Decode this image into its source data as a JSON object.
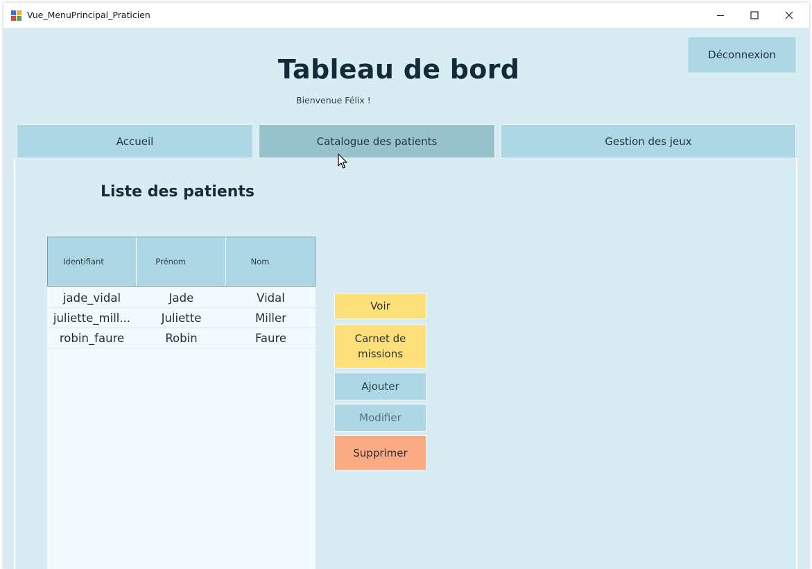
{
  "window": {
    "title": "Vue_MenuPrincipal_Praticien"
  },
  "header": {
    "logout_label": "Déconnexion",
    "title": "Tableau de bord",
    "welcome": "Bienvenue Félix !"
  },
  "tabs": [
    {
      "label": "Accueil",
      "active": false
    },
    {
      "label": "Catalogue des patients",
      "active": true
    },
    {
      "label": "Gestion des jeux",
      "active": false
    }
  ],
  "patients": {
    "title": "Liste des patients",
    "columns": [
      "Identifiant",
      "Prénom",
      "Nom"
    ],
    "rows": [
      [
        "jade_vidal",
        "Jade",
        "Vidal"
      ],
      [
        "juliette_mill...",
        "Juliette",
        "Miller"
      ],
      [
        "robin_faure",
        "Robin",
        "Faure"
      ]
    ]
  },
  "actions": {
    "voir": "Voir",
    "carnet": "Carnet de missions",
    "ajouter": "Ajouter",
    "modifier": "Modifier",
    "supprimer": "Supprimer"
  },
  "colors": {
    "background": "#d8edf3",
    "tab": "#add7e4",
    "tab_active": "#97c2cd",
    "yellow_button": "#fde07a",
    "delete_button": "#fbab84"
  },
  "icons": {
    "app": "app-icon",
    "minimize": "minimize-icon",
    "maximize": "maximize-icon",
    "close": "close-icon",
    "cursor": "mouse-cursor-icon"
  }
}
